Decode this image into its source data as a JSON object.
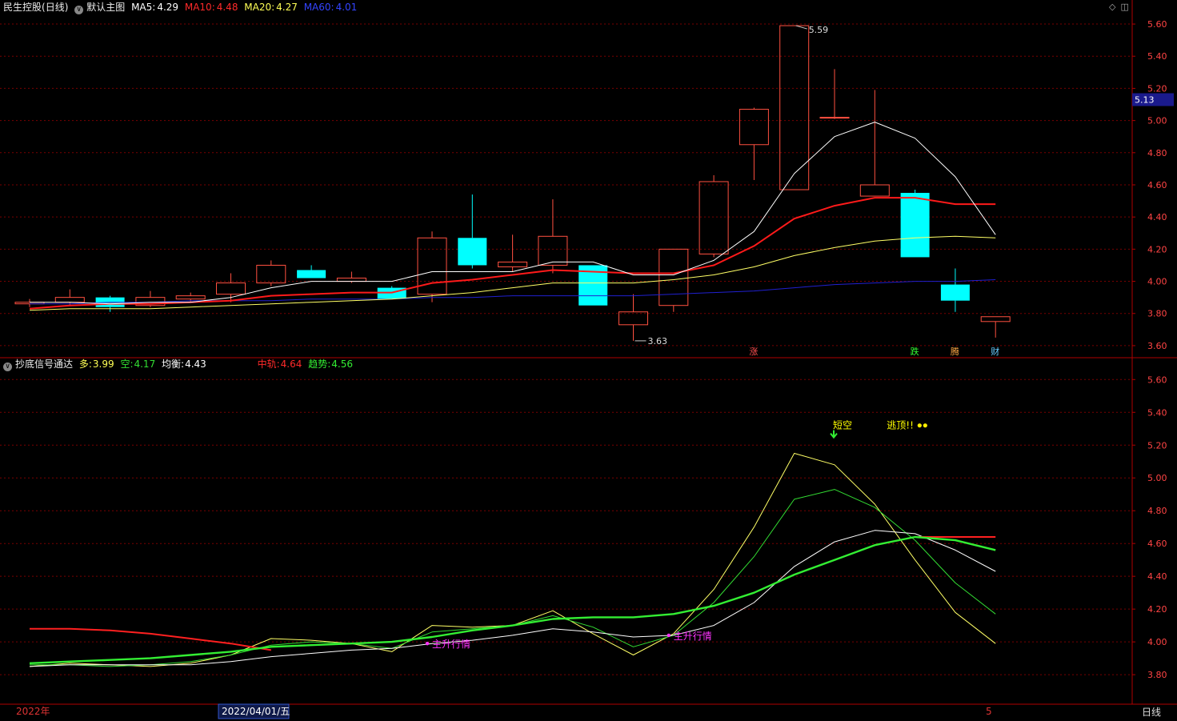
{
  "header1": {
    "stock": "民生控股",
    "period": "(日线)",
    "template": "默认主图",
    "ma5_label": "MA5:",
    "ma5_value": "4.29",
    "ma10_label": "MA10:",
    "ma10_value": "4.48",
    "ma20_label": "MA20:",
    "ma20_value": "4.27",
    "ma60_label": "MA60:",
    "ma60_value": "4.01"
  },
  "header2": {
    "indicator": "抄底信号通达",
    "duo_label": "多:",
    "duo_value": "3.99",
    "kong_label": "空:",
    "kong_value": "4.17",
    "junheng_label": "均衡:",
    "junheng_value": "4.43",
    "zhongzhou_label": "中轨:",
    "zhongzhou_value": "4.64",
    "qushi_label": "趋势:",
    "qushi_value": "4.56"
  },
  "colors": {
    "up": "#ff5040",
    "down": "#00ffff",
    "ma5": "#ffffff",
    "ma10": "#ff1a1a",
    "ma20": "#ffff66",
    "ma60": "#2020d0",
    "grid": "#7a0000",
    "axis": "#b00000",
    "trend": "#33ee33",
    "midrail": "#ff2020",
    "signal": "#ff33ff",
    "escape": "#ffff00",
    "current_price_bg": "#1a1a8c"
  },
  "chart_data": [
    {
      "type": "candlestick",
      "title": "民生控股 (日线)",
      "y_ticks": [
        "5.60",
        "5.40",
        "5.20",
        "5.00",
        "4.80",
        "4.60",
        "4.40",
        "4.20",
        "4.00",
        "3.80",
        "3.60"
      ],
      "ylim": [
        3.53,
        5.66
      ],
      "current_price": "5.13",
      "candles": [
        {
          "o": 3.86,
          "h": 3.89,
          "l": 3.84,
          "c": 3.87
        },
        {
          "o": 3.87,
          "h": 3.95,
          "l": 3.85,
          "c": 3.9
        },
        {
          "o": 3.9,
          "h": 3.91,
          "l": 3.81,
          "c": 3.84
        },
        {
          "o": 3.85,
          "h": 3.94,
          "l": 3.84,
          "c": 3.9
        },
        {
          "o": 3.89,
          "h": 3.93,
          "l": 3.87,
          "c": 3.91
        },
        {
          "o": 3.92,
          "h": 4.05,
          "l": 3.87,
          "c": 3.99
        },
        {
          "o": 3.99,
          "h": 4.13,
          "l": 3.97,
          "c": 4.1
        },
        {
          "o": 4.07,
          "h": 4.1,
          "l": 4.02,
          "c": 4.02
        },
        {
          "o": 4.0,
          "h": 4.06,
          "l": 3.99,
          "c": 4.02
        },
        {
          "o": 3.96,
          "h": 3.97,
          "l": 3.9,
          "c": 3.89
        },
        {
          "o": 3.92,
          "h": 4.31,
          "l": 3.87,
          "c": 4.27
        },
        {
          "o": 4.27,
          "h": 4.54,
          "l": 4.08,
          "c": 4.1
        },
        {
          "o": 4.09,
          "h": 4.29,
          "l": 4.06,
          "c": 4.12
        },
        {
          "o": 4.1,
          "h": 4.51,
          "l": 4.05,
          "c": 4.28
        },
        {
          "o": 4.1,
          "h": 4.1,
          "l": 3.85,
          "c": 3.85
        },
        {
          "o": 3.73,
          "h": 3.92,
          "l": 3.63,
          "c": 3.81
        },
        {
          "o": 3.85,
          "h": 4.2,
          "l": 3.81,
          "c": 4.2
        },
        {
          "o": 4.17,
          "h": 4.66,
          "l": 4.15,
          "c": 4.62
        },
        {
          "o": 4.85,
          "h": 5.08,
          "l": 4.63,
          "c": 5.07
        },
        {
          "o": 4.57,
          "h": 5.59,
          "l": 4.57,
          "c": 5.59
        },
        {
          "o": 5.02,
          "h": 5.32,
          "l": 5.01,
          "c": 5.02
        },
        {
          "o": 4.53,
          "h": 5.19,
          "l": 4.53,
          "c": 4.6
        },
        {
          "o": 4.55,
          "h": 4.57,
          "l": 4.15,
          "c": 4.15
        },
        {
          "o": 3.98,
          "h": 4.08,
          "l": 3.81,
          "c": 3.88
        },
        {
          "o": 3.75,
          "h": 3.78,
          "l": 3.65,
          "c": 3.78
        }
      ],
      "ma5": [
        3.87,
        3.87,
        3.86,
        3.87,
        3.87,
        3.9,
        3.96,
        4.0,
        4.0,
        4.0,
        4.06,
        4.06,
        4.06,
        4.12,
        4.12,
        4.04,
        4.04,
        4.13,
        4.31,
        4.67,
        4.9,
        4.99,
        4.89,
        4.65,
        4.29
      ],
      "ma10": [
        3.83,
        3.85,
        3.86,
        3.86,
        3.87,
        3.88,
        3.91,
        3.92,
        3.93,
        3.93,
        3.99,
        4.01,
        4.04,
        4.07,
        4.06,
        4.05,
        4.05,
        4.1,
        4.22,
        4.39,
        4.47,
        4.52,
        4.52,
        4.48,
        4.48
      ],
      "ma20": [
        3.82,
        3.83,
        3.83,
        3.83,
        3.84,
        3.85,
        3.86,
        3.87,
        3.88,
        3.89,
        3.91,
        3.93,
        3.96,
        3.99,
        3.99,
        3.99,
        4.01,
        4.04,
        4.09,
        4.16,
        4.21,
        4.25,
        4.27,
        4.28,
        4.27
      ],
      "ma60": [
        3.86,
        3.86,
        3.87,
        3.87,
        3.88,
        3.88,
        3.88,
        3.89,
        3.89,
        3.89,
        3.9,
        3.9,
        3.91,
        3.91,
        3.91,
        3.91,
        3.92,
        3.93,
        3.94,
        3.96,
        3.98,
        3.99,
        4.0,
        4.0,
        4.01
      ],
      "annotations": [
        {
          "i": 19,
          "price": 5.59,
          "text": "5.59",
          "at": "high"
        },
        {
          "i": 15,
          "price": 3.63,
          "text": "3.63",
          "at": "low"
        }
      ],
      "tags": [
        {
          "i": 18,
          "text": "涨",
          "color": "#ff5050"
        },
        {
          "i": 22,
          "text": "跌",
          "color": "#33ff33"
        },
        {
          "i": 23,
          "text": "腾",
          "color": "#ffaa44"
        },
        {
          "i": 24,
          "text": "财",
          "color": "#66ccff"
        }
      ]
    },
    {
      "type": "line",
      "title": "抄底信号通达",
      "y_ticks": [
        "5.60",
        "5.40",
        "5.20",
        "5.00",
        "4.80",
        "4.60",
        "4.40",
        "4.20",
        "4.00",
        "3.80"
      ],
      "ylim": [
        3.62,
        5.66
      ],
      "series": [
        {
          "name": "多",
          "color": "#ffff66",
          "width": 1,
          "values": [
            3.85,
            3.87,
            3.86,
            3.85,
            3.87,
            3.92,
            4.02,
            4.01,
            3.99,
            3.94,
            4.1,
            4.09,
            4.1,
            4.19,
            4.05,
            3.92,
            4.05,
            4.32,
            4.7,
            5.15,
            5.08,
            4.84,
            4.5,
            4.18,
            3.99
          ]
        },
        {
          "name": "空",
          "color": "#33dd33",
          "width": 1,
          "values": [
            3.86,
            3.86,
            3.85,
            3.86,
            3.88,
            3.92,
            3.98,
            4.0,
            3.99,
            3.96,
            4.06,
            4.08,
            4.1,
            4.16,
            4.09,
            3.97,
            4.04,
            4.24,
            4.52,
            4.87,
            4.93,
            4.82,
            4.62,
            4.36,
            4.17
          ]
        },
        {
          "name": "均衡",
          "color": "#ffffff",
          "width": 1,
          "values": [
            3.85,
            3.86,
            3.86,
            3.86,
            3.86,
            3.88,
            3.91,
            3.93,
            3.95,
            3.96,
            3.99,
            4.01,
            4.04,
            4.08,
            4.06,
            4.03,
            4.04,
            4.1,
            4.24,
            4.46,
            4.61,
            4.68,
            4.66,
            4.56,
            4.43
          ]
        },
        {
          "name": "中轨",
          "color": "#ff2020",
          "width": 2,
          "values": [
            4.08,
            4.08,
            4.07,
            4.05,
            4.02,
            3.99,
            3.95,
            null,
            null,
            null,
            null,
            null,
            null,
            null,
            null,
            null,
            null,
            null,
            null,
            null,
            null,
            null,
            4.64,
            4.64,
            4.64
          ]
        },
        {
          "name": "趋势",
          "color": "#33ee33",
          "width": 2.4,
          "values": [
            3.87,
            3.88,
            3.89,
            3.9,
            3.92,
            3.94,
            3.97,
            3.98,
            3.99,
            4.0,
            4.03,
            4.07,
            4.1,
            4.14,
            4.15,
            4.15,
            4.17,
            4.22,
            4.3,
            4.41,
            4.5,
            4.59,
            4.64,
            4.62,
            4.56
          ]
        }
      ],
      "signals": [
        {
          "i": 10,
          "price": 3.99,
          "text": "主升行情",
          "color": "#ff33ff"
        },
        {
          "i": 16,
          "price": 4.04,
          "text": "主升行情",
          "color": "#ff33ff"
        },
        {
          "i": 20,
          "price": 5.32,
          "text": "短空",
          "color": "#ffff00"
        },
        {
          "i": 21,
          "price": 5.32,
          "text": "逃顶!!",
          "color": "#ffff00"
        }
      ]
    }
  ],
  "bottom_bar": {
    "year": "2022年",
    "cursor_date": "2022/04/01/五",
    "right_number": "5",
    "period_button": "日线"
  }
}
